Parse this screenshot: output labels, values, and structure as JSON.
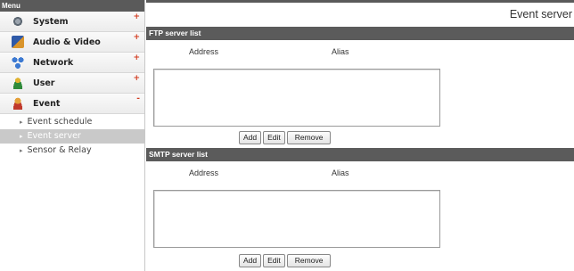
{
  "menu": {
    "title": "Menu",
    "items": [
      {
        "label": "System",
        "icon": "gear-icon",
        "sign": "+"
      },
      {
        "label": "Audio & Video",
        "icon": "audio-video-icon",
        "sign": "+"
      },
      {
        "label": "Network",
        "icon": "network-icon",
        "sign": "+"
      },
      {
        "label": "User",
        "icon": "user-icon",
        "sign": "+"
      },
      {
        "label": "Event",
        "icon": "event-icon",
        "sign": "-"
      }
    ],
    "event_subitems": [
      {
        "label": "Event schedule"
      },
      {
        "label": "Event server"
      },
      {
        "label": "Sensor & Relay"
      }
    ]
  },
  "page": {
    "title": "Event server"
  },
  "ftp": {
    "header": "FTP server list",
    "col_address": "Address",
    "col_alias": "Alias",
    "add": "Add",
    "edit": "Edit",
    "remove": "Remove"
  },
  "smtp": {
    "header": "SMTP server list",
    "col_address": "Address",
    "col_alias": "Alias",
    "add": "Add",
    "edit": "Edit",
    "remove": "Remove"
  },
  "colors": {
    "accent_sign": "#d23a1e",
    "header_bg": "#5b5b5b",
    "active_sub_bg": "#c9c9c9"
  }
}
